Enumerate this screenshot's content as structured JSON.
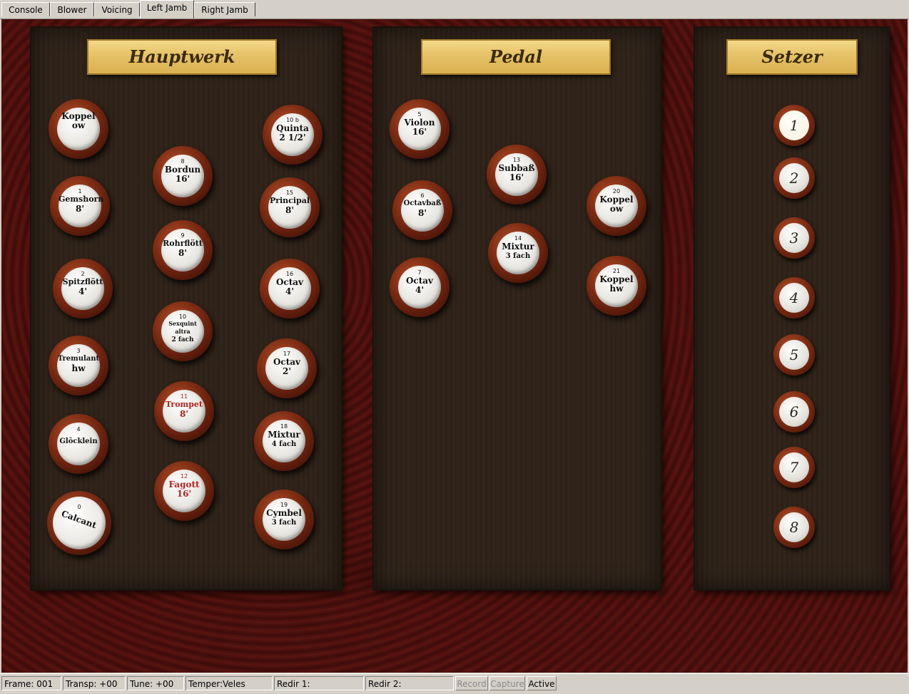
{
  "tabs": [
    {
      "label": "Console"
    },
    {
      "label": "Blower"
    },
    {
      "label": "Voicing"
    },
    {
      "label": "Left Jamb"
    },
    {
      "label": "Right Jamb"
    }
  ],
  "active_tab": "Left Jamb",
  "divisions": {
    "hauptwerk": "Hauptwerk",
    "pedal": "Pedal",
    "setzer": "Setzer"
  },
  "hauptwerk_stops": [
    {
      "num": "",
      "name": "Koppel",
      "pitch": "ow"
    },
    {
      "num": "1",
      "name": "Gemshorn",
      "pitch": "8'"
    },
    {
      "num": "2",
      "name": "Spitzflött",
      "pitch": "4'"
    },
    {
      "num": "3",
      "name": "Tremulant",
      "pitch": "hw"
    },
    {
      "num": "4",
      "name": "Glöcklein",
      "pitch": ""
    },
    {
      "num": "0",
      "name": "Calcant",
      "pitch": "",
      "state": "pulled"
    },
    {
      "num": "8",
      "name": "Bordun",
      "pitch": "16'"
    },
    {
      "num": "9",
      "name": "Rohrflött",
      "pitch": "8'"
    },
    {
      "num": "10",
      "name": "Sexquint altra",
      "pitch": "2 fach"
    },
    {
      "num": "11",
      "name": "Trompet",
      "pitch": "8'",
      "color": "red"
    },
    {
      "num": "12",
      "name": "Fagott",
      "pitch": "16'",
      "color": "red"
    },
    {
      "num": "10 b",
      "name": "Quinta",
      "pitch": "2 1/2'"
    },
    {
      "num": "15",
      "name": "Principal",
      "pitch": "8'"
    },
    {
      "num": "16",
      "name": "Octav",
      "pitch": "4'"
    },
    {
      "num": "17",
      "name": "Octav",
      "pitch": "2'"
    },
    {
      "num": "18",
      "name": "Mixtur",
      "pitch": "4 fach"
    },
    {
      "num": "19",
      "name": "Cymbel",
      "pitch": "3 fach"
    }
  ],
  "pedal_stops": [
    {
      "num": "5",
      "name": "Violon",
      "pitch": "16'"
    },
    {
      "num": "6",
      "name": "Octavbaß",
      "pitch": "8'"
    },
    {
      "num": "7",
      "name": "Octav",
      "pitch": "4'"
    },
    {
      "num": "13",
      "name": "Subbaß",
      "pitch": "16'"
    },
    {
      "num": "14",
      "name": "Mixtur",
      "pitch": "3 fach"
    },
    {
      "num": "20",
      "name": "Koppel",
      "pitch": "ow"
    },
    {
      "num": "21",
      "name": "Koppel",
      "pitch": "hw"
    }
  ],
  "setzer_buttons": [
    "1",
    "2",
    "3",
    "4",
    "5",
    "6",
    "7",
    "8"
  ],
  "setzer_active": "1",
  "status": {
    "frame": "Frame: 001",
    "transp": "Transp: +00",
    "tune": "Tune: +00",
    "temper": "Temper:Veles",
    "redir1": "Redir 1:",
    "redir2": "Redir 2:",
    "record": "Record",
    "capture": "Capture",
    "active": "Active"
  }
}
